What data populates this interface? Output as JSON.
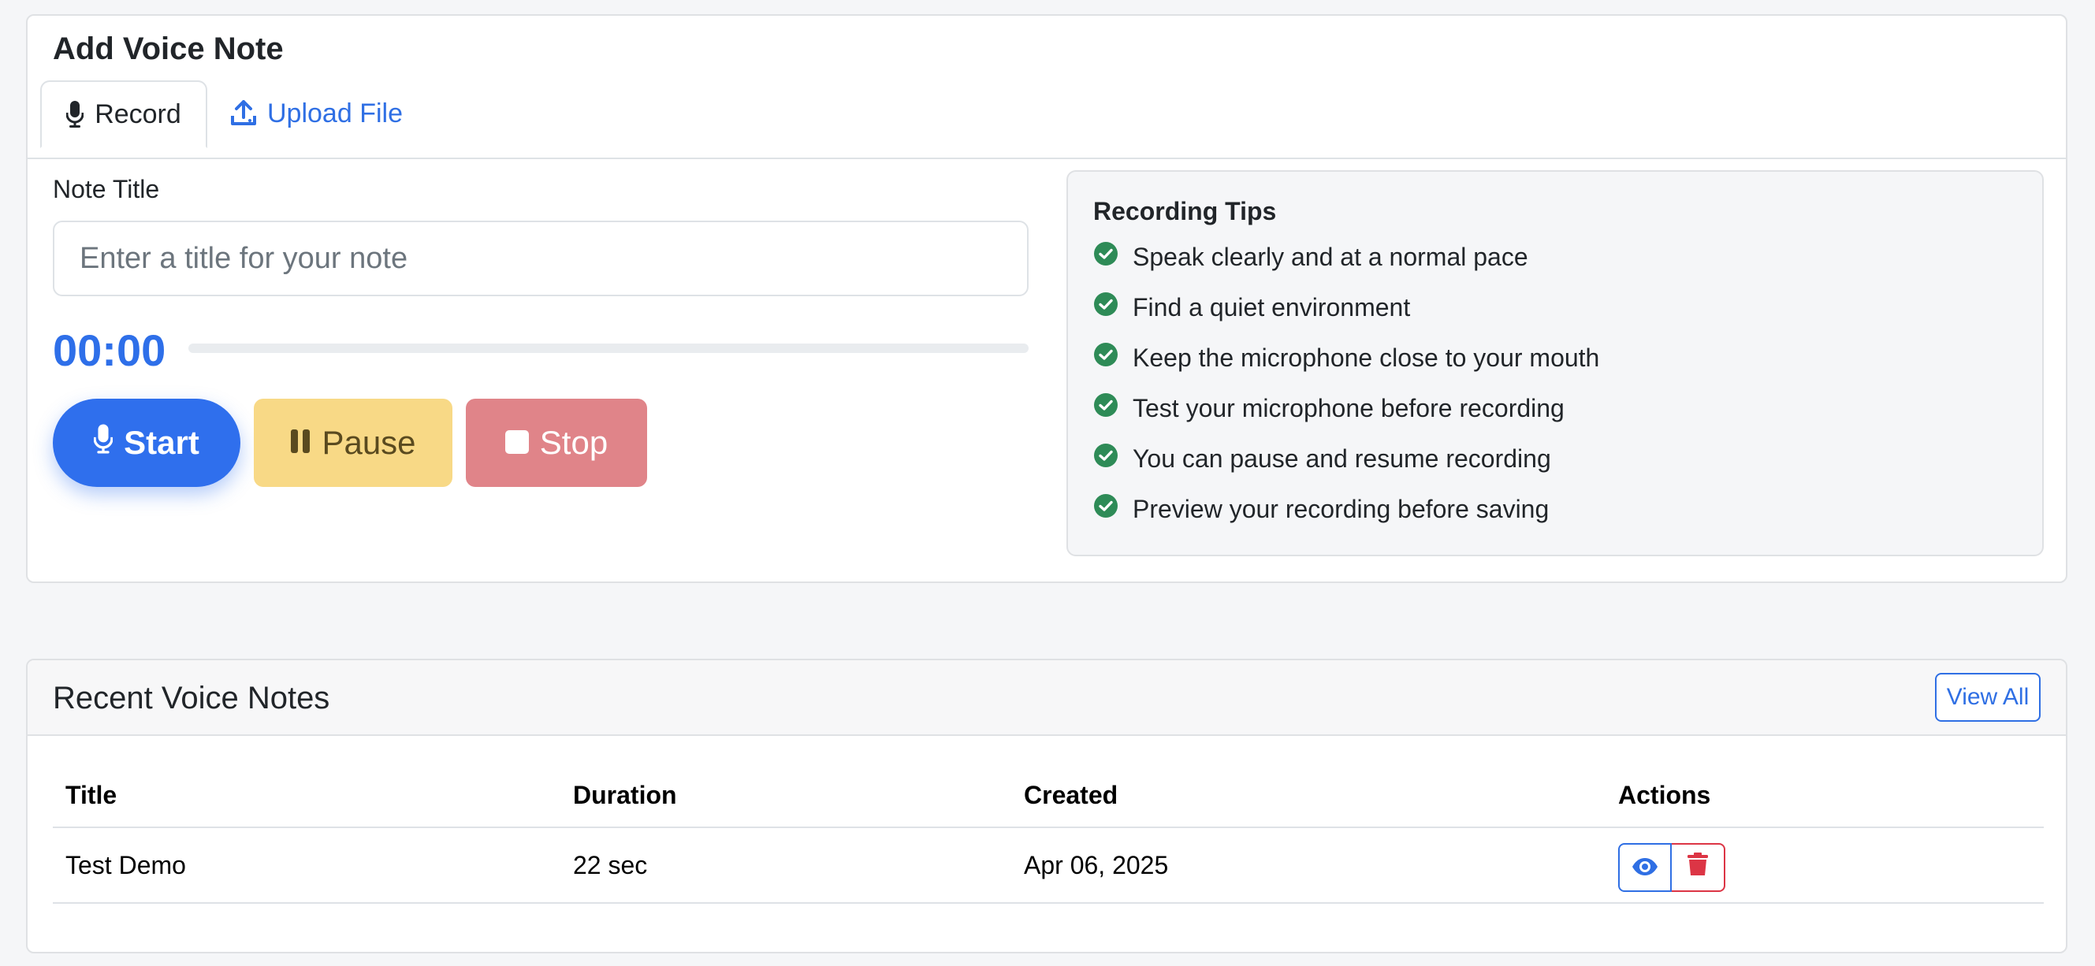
{
  "voice_card": {
    "title": "Add Voice Note",
    "tabs": [
      {
        "label": "Record",
        "icon": "microphone-icon",
        "active": true
      },
      {
        "label": "Upload File",
        "icon": "upload-icon",
        "active": false
      }
    ],
    "note_title_label": "Note Title",
    "note_title_placeholder": "Enter a title for your note",
    "note_title_value": "",
    "timer": "00:00",
    "progress": 0,
    "buttons": {
      "start": "Start",
      "pause": "Pause",
      "stop": "Stop"
    },
    "tips": {
      "title": "Recording Tips",
      "items": [
        "Speak clearly and at a normal pace",
        "Find a quiet environment",
        "Keep the microphone close to your mouth",
        "Test your microphone before recording",
        "You can pause and resume recording",
        "Preview your recording before saving"
      ]
    }
  },
  "recent": {
    "title": "Recent Voice Notes",
    "view_all": "View All",
    "columns": [
      "Title",
      "Duration",
      "Created",
      "Actions"
    ],
    "rows": [
      {
        "title": "Test Demo",
        "duration": "22 sec",
        "created": "Apr 06, 2025"
      }
    ]
  },
  "colors": {
    "primary": "#2f6fed",
    "warning": "#f8d986",
    "danger": "#e08489",
    "success": "#2e8b57"
  }
}
